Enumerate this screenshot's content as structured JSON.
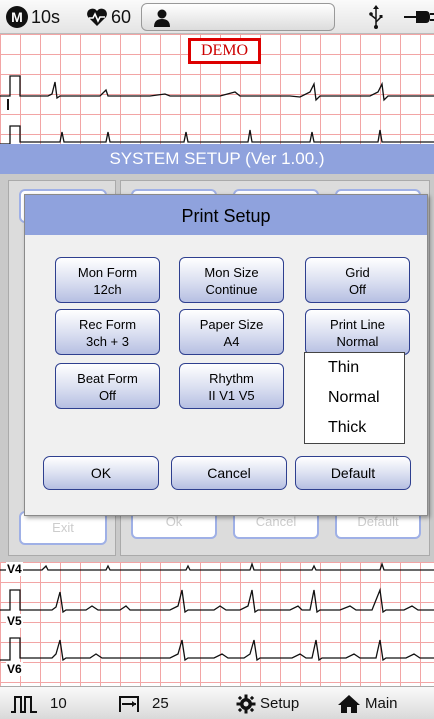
{
  "status_bar": {
    "mode_badge": "M",
    "time": "10s",
    "heart_rate": "60"
  },
  "demo_label": "DEMO",
  "system_setup": {
    "title": "SYSTEM SETUP (Ver 1.00.)",
    "ghost_buttons": {
      "exit": "Exit",
      "ok": "Ok",
      "cancel": "Cancel",
      "default": "Default"
    }
  },
  "print_setup": {
    "title": "Print Setup",
    "options": [
      {
        "label": "Mon Form",
        "value": "12ch"
      },
      {
        "label": "Mon Size",
        "value": "Continue"
      },
      {
        "label": "Grid",
        "value": "Off"
      },
      {
        "label": "Rec Form",
        "value": "3ch + 3"
      },
      {
        "label": "Paper Size",
        "value": "A4"
      },
      {
        "label": "Print Line",
        "value": "Normal"
      },
      {
        "label": "Beat Form",
        "value": "Off"
      },
      {
        "label": "Rhythm",
        "value": "II  V1  V5"
      }
    ],
    "dropdown_options": [
      "Thin",
      "Normal",
      "Thick"
    ],
    "buttons": {
      "ok": "OK",
      "cancel": "Cancel",
      "default": "Default"
    }
  },
  "leads": {
    "v4": "V4",
    "v5": "V5",
    "v6": "V6"
  },
  "bottom_bar": {
    "filter_value": "10",
    "speed_value": "25",
    "setup_label": "Setup",
    "main_label": "Main"
  }
}
